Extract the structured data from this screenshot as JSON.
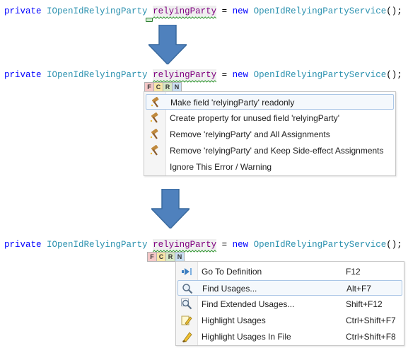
{
  "code": {
    "kw_private": "private",
    "type_interface": "IOpenIdRelyingParty",
    "identifier": "relyingParty",
    "op_assign": "=",
    "kw_new": "new",
    "type_service": "OpenIdRelyingPartyService",
    "tail": "();"
  },
  "quickbar": {
    "f": "F",
    "c": "C",
    "r": "R",
    "n": "N"
  },
  "quickfix_menu": {
    "items": [
      {
        "label": "Make field 'relyingParty' readonly",
        "icon": "hammer-icon"
      },
      {
        "label": "Create property for unused field 'relyingParty'",
        "icon": "hammer-icon"
      },
      {
        "label": "Remove 'relyingParty' and All Assignments",
        "icon": "hammer-icon"
      },
      {
        "label": "Remove 'relyingParty' and Keep Side-effect Assignments",
        "icon": "hammer-icon"
      },
      {
        "label": "Ignore This Error / Warning",
        "icon": ""
      }
    ]
  },
  "navigate_menu": {
    "items": [
      {
        "label": "Go To Definition",
        "shortcut": "F12",
        "icon": "go-to-definition-icon"
      },
      {
        "label": "Find Usages...",
        "shortcut": "Alt+F7",
        "icon": "magnifier-icon"
      },
      {
        "label": "Find Extended Usages...",
        "shortcut": "Shift+F12",
        "icon": "magnifier-extended-icon"
      },
      {
        "label": "Highlight Usages",
        "shortcut": "Ctrl+Shift+F7",
        "icon": "highlight-icon"
      },
      {
        "label": "Highlight Usages In File",
        "shortcut": "Ctrl+Shift+F8",
        "icon": "highlight-file-icon"
      }
    ]
  },
  "colors": {
    "keyword": "#0000ff",
    "type": "#2b91af",
    "identifier": "#800080",
    "arrow": "#4f81bd",
    "selection_border": "#aac6e6"
  }
}
